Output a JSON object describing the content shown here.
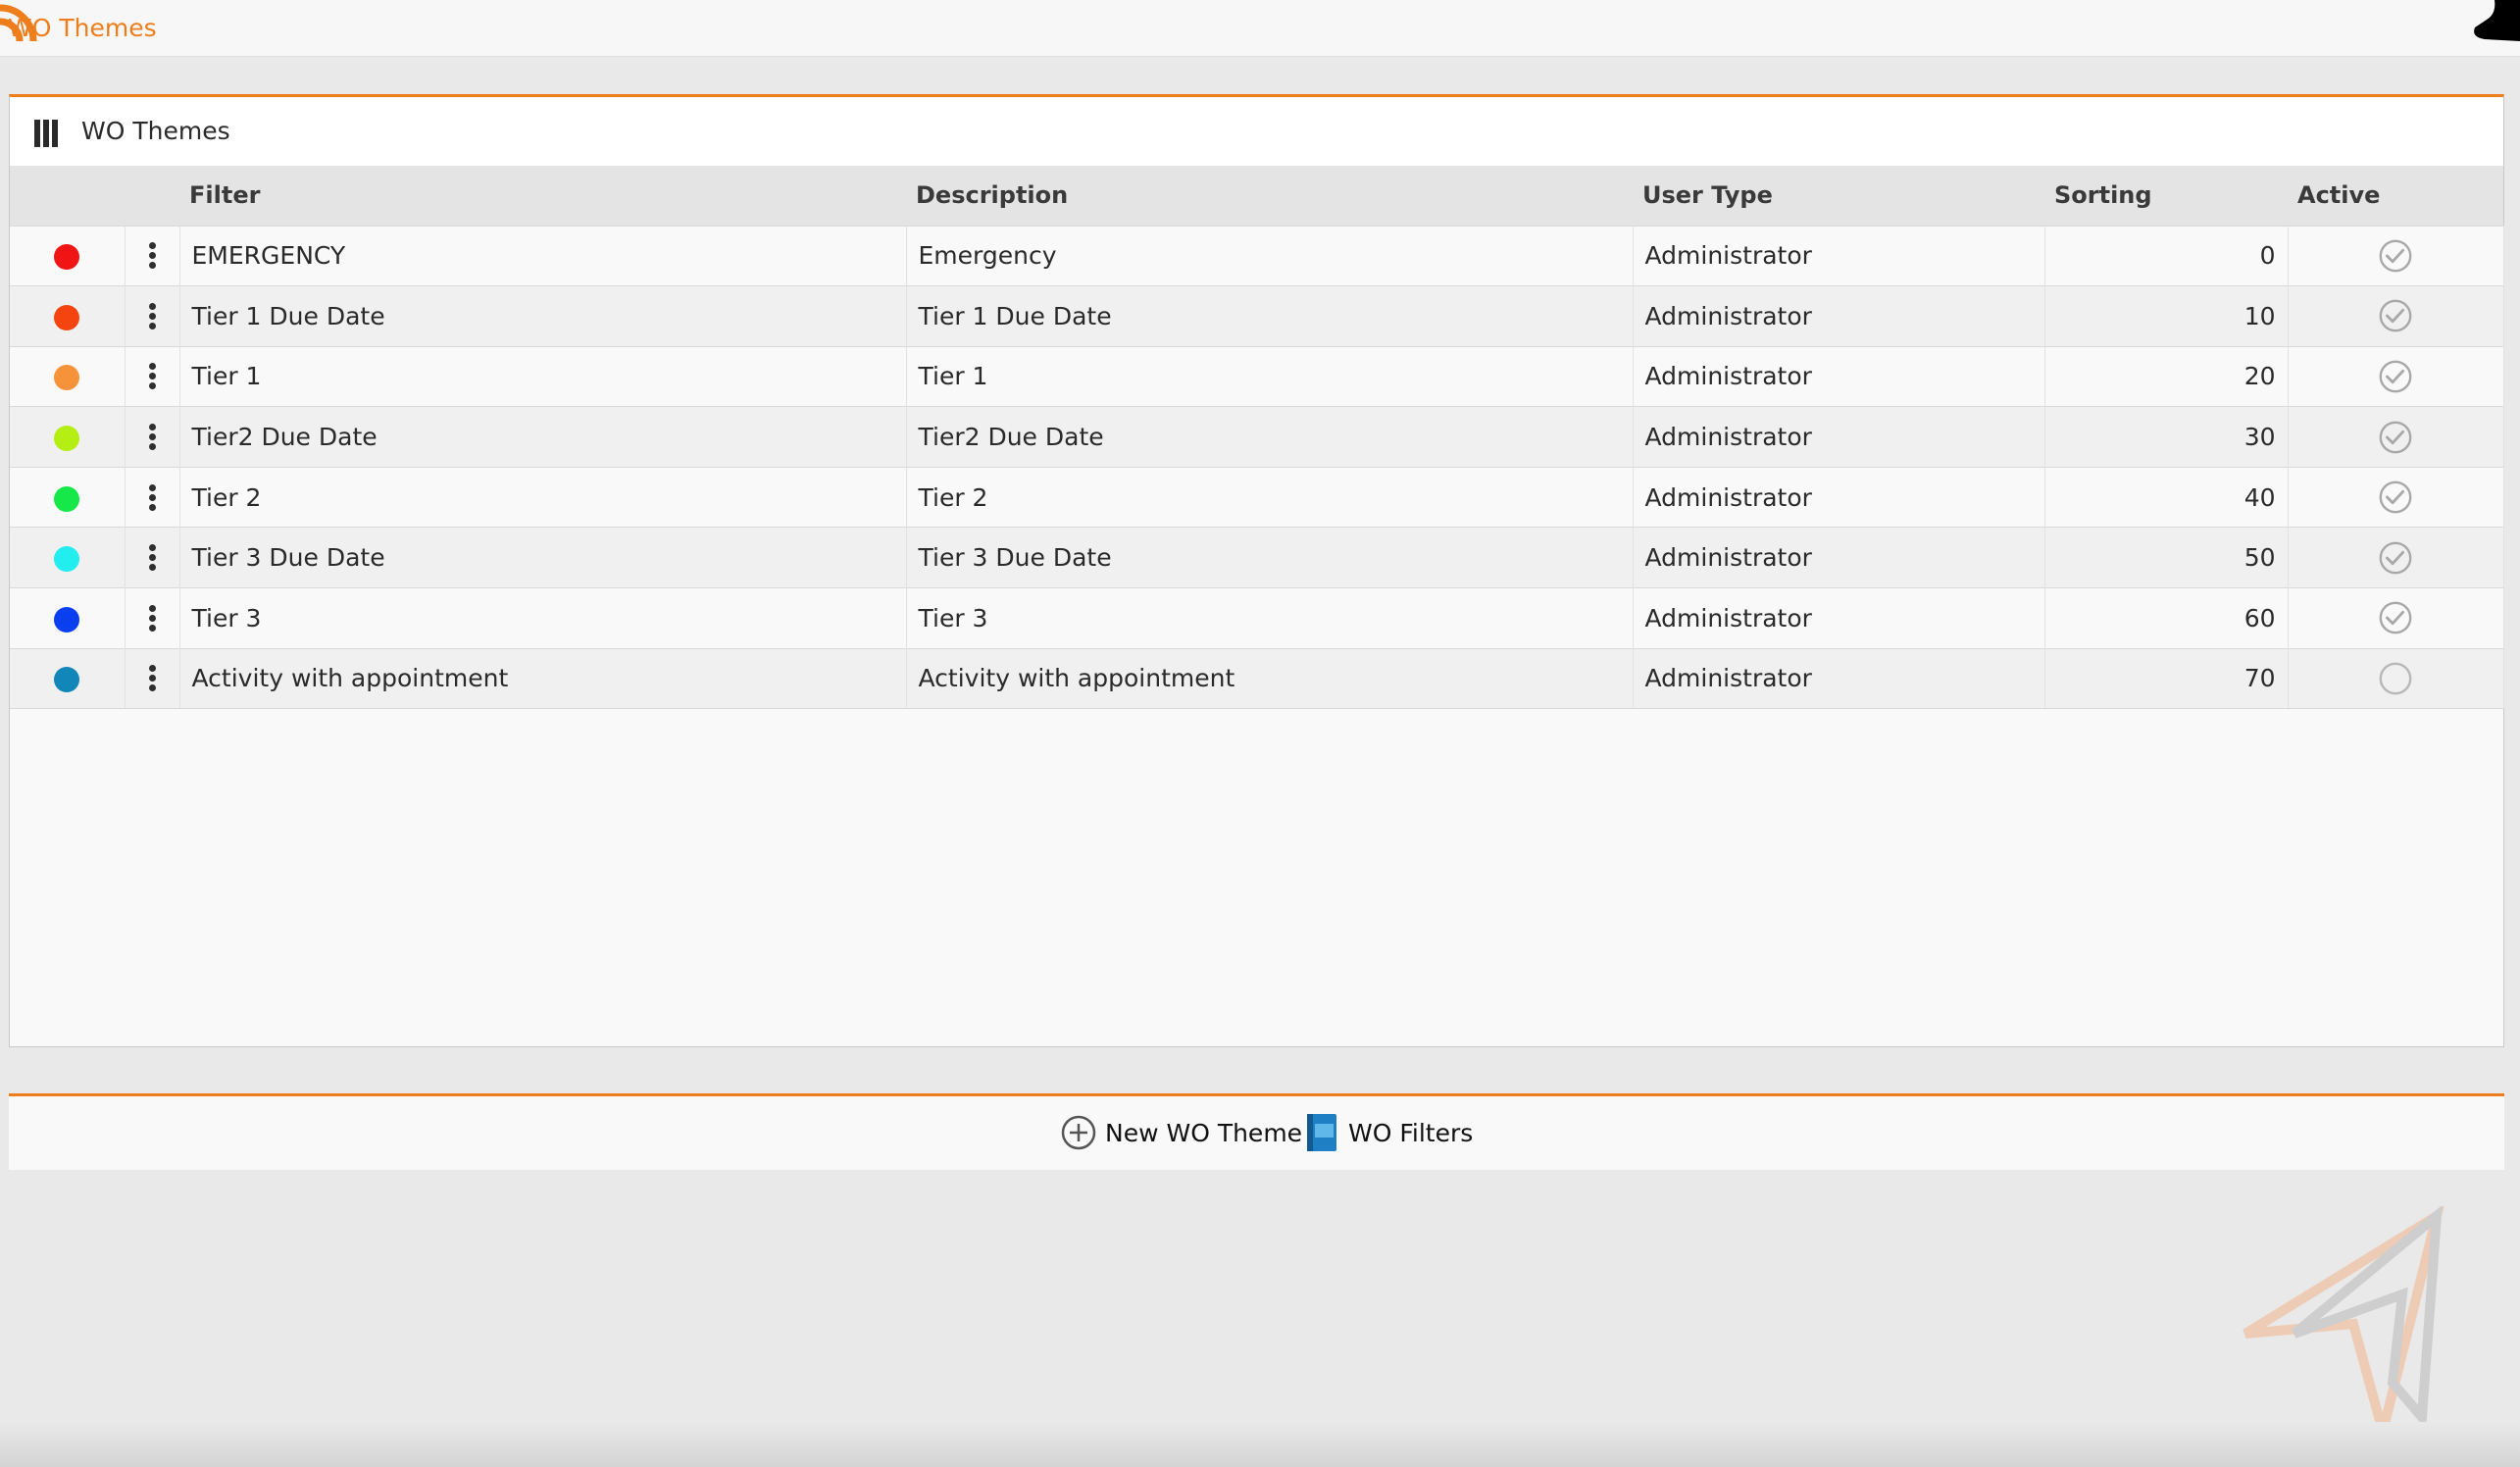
{
  "app": {
    "title": "WO Themes"
  },
  "panel": {
    "title": "WO Themes"
  },
  "columns": {
    "filter": "Filter",
    "description": "Description",
    "user_type": "User Type",
    "sorting": "Sorting",
    "active": "Active"
  },
  "rows": [
    {
      "color": "#f01414",
      "filter": "EMERGENCY",
      "description": "Emergency",
      "user_type": "Administrator",
      "sorting": "0",
      "active": true
    },
    {
      "color": "#f5440f",
      "filter": "Tier 1 Due Date",
      "description": "Tier 1 Due Date",
      "user_type": "Administrator",
      "sorting": "10",
      "active": true
    },
    {
      "color": "#f5923a",
      "filter": "Tier 1",
      "description": "Tier 1",
      "user_type": "Administrator",
      "sorting": "20",
      "active": true
    },
    {
      "color": "#b5ee12",
      "filter": "Tier2 Due Date",
      "description": "Tier2 Due Date",
      "user_type": "Administrator",
      "sorting": "30",
      "active": true
    },
    {
      "color": "#16e84a",
      "filter": "Tier 2",
      "description": "Tier 2",
      "user_type": "Administrator",
      "sorting": "40",
      "active": true
    },
    {
      "color": "#22eef0",
      "filter": "Tier 3 Due Date",
      "description": "Tier 3 Due Date",
      "user_type": "Administrator",
      "sorting": "50",
      "active": true
    },
    {
      "color": "#0a3ff0",
      "filter": "Tier 3",
      "description": "Tier 3",
      "user_type": "Administrator",
      "sorting": "60",
      "active": true
    },
    {
      "color": "#1286b8",
      "filter": "Activity with appointment",
      "description": "Activity with appointment",
      "user_type": "Administrator",
      "sorting": "70",
      "active": false
    }
  ],
  "toolbar": {
    "new_label": "New WO Theme",
    "filters_label": "WO Filters"
  },
  "colors": {
    "accent": "#ee7d1c"
  },
  "icons": {
    "grid": "column-bars-icon",
    "new": "plus-circle-icon",
    "filters": "sql-book-icon",
    "row_menu": "kebab-menu-icon",
    "active": "check-circle-icon"
  }
}
